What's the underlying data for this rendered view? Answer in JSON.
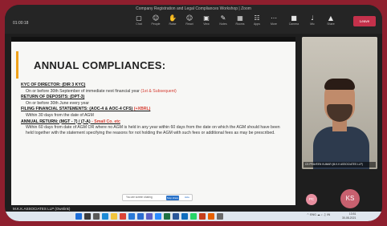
{
  "window": {
    "title": "Company Registration and Legal Compliances Workshop | Zoom",
    "time": "01:00:18"
  },
  "toolbar": {
    "items": [
      {
        "icon": "chat-icon",
        "glyph": "▢",
        "label": "Chat"
      },
      {
        "icon": "people-icon",
        "glyph": "☺",
        "label": "People"
      },
      {
        "icon": "raise-hand-icon",
        "glyph": "✋",
        "label": "Raise"
      },
      {
        "icon": "react-icon",
        "glyph": "☺",
        "label": "React"
      },
      {
        "icon": "view-icon",
        "glyph": "▣",
        "label": "View"
      },
      {
        "icon": "notes-icon",
        "glyph": "✎",
        "label": "Notes"
      },
      {
        "icon": "rooms-icon",
        "glyph": "▦",
        "label": "Rooms"
      },
      {
        "icon": "apps-icon",
        "glyph": "☷",
        "label": "Apps"
      },
      {
        "icon": "more-icon",
        "glyph": "⋯",
        "label": "More"
      }
    ],
    "right_items": [
      {
        "icon": "camera-icon",
        "glyph": "■",
        "label": "Camera"
      },
      {
        "icon": "mic-icon",
        "glyph": "♩",
        "label": "Mic"
      },
      {
        "icon": "share-icon",
        "glyph": "▲",
        "label": "Share"
      }
    ],
    "leave_label": "Leave"
  },
  "slide": {
    "heading": "ANNUAL COMPLIANCES:",
    "lines": [
      {
        "type": "h",
        "text": "KYC OF DIRECTOR: (DIR 3 KYC)",
        "red": ""
      },
      {
        "type": "b",
        "text": "On or before 30th September of immediate next financial year ",
        "red": "(1st & Subsequent)"
      },
      {
        "type": "h",
        "text": "RETURN OF DEPOSITS: (DPT-3)",
        "red": ""
      },
      {
        "type": "b",
        "text": "On or before 30th June every year",
        "red": ""
      },
      {
        "type": "h",
        "text": "FILING FINANCIAL STATEMENTS: (AOC-4 & AOC-4 CFS) ",
        "red": "(+XBRL)"
      },
      {
        "type": "b",
        "text": "Within 30 days from the date of AGM",
        "red": ""
      },
      {
        "type": "h",
        "text": "ANNUAL RETURN: (MGT - 7) / (7-A) ",
        "red": "- Small Co. etc"
      }
    ],
    "paragraph": "Within 60 days from date of AGM OR where no AGM is held in any year within 60 days from the date on which the AGM should have been held together with the statement specifying the reasons for not holding the AGM with such fees or additional fees as may be prescribed.",
    "share_notice": "You are screen sharing",
    "stop_share_label": "Stop share",
    "hide_label": "Hide"
  },
  "presenter": "M.K.K.ASSOCIATES LLP (Ownlink)",
  "video": {
    "name": "CS PRAVEEN KUMAR (M.K.K ASSOCIATES LLP)"
  },
  "participants": {
    "small_initials": "PC",
    "large_initials": "KS"
  },
  "taskbar": {
    "icons": [
      {
        "name": "start-icon",
        "color": "#1e6fd9"
      },
      {
        "name": "search-icon",
        "color": "#3c3c3c"
      },
      {
        "name": "taskview-icon",
        "color": "#5a5a5a"
      },
      {
        "name": "edge-icon",
        "color": "#1c8ad6"
      },
      {
        "name": "explorer-icon",
        "color": "#f2c43d"
      },
      {
        "name": "chrome-icon",
        "color": "#db4437"
      },
      {
        "name": "store-icon",
        "color": "#2a7ad8"
      },
      {
        "name": "mail-icon",
        "color": "#2b6ccf"
      },
      {
        "name": "teams-icon",
        "color": "#5b5fc7"
      },
      {
        "name": "zoom-icon",
        "color": "#2d8cff"
      },
      {
        "name": "excel-icon",
        "color": "#1f7244"
      },
      {
        "name": "word-icon",
        "color": "#2b579a"
      },
      {
        "name": "outlook-icon",
        "color": "#0f6cbd"
      },
      {
        "name": "whatsapp-icon",
        "color": "#25d366"
      },
      {
        "name": "powerpoint-icon",
        "color": "#c43e1c"
      },
      {
        "name": "firefox-icon",
        "color": "#e66000"
      },
      {
        "name": "settings-icon",
        "color": "#6a6a6a"
      }
    ],
    "tray": "^ ENG ☁ ⌕ ♫",
    "lang": "IN",
    "time": "13:51",
    "date": "30-08-2021"
  }
}
